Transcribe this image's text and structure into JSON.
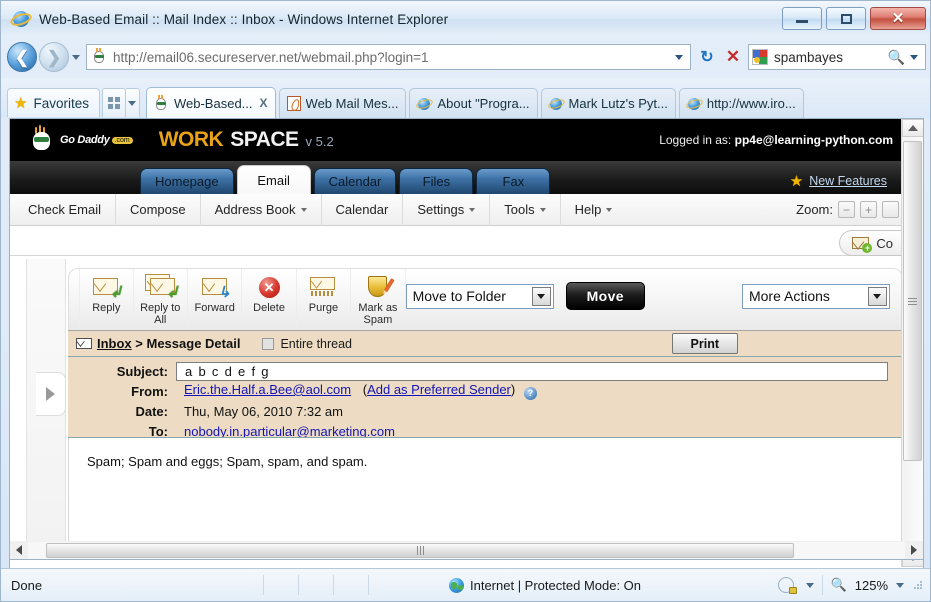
{
  "window": {
    "title": "Web-Based Email :: Mail Index :: Inbox - Windows Internet Explorer",
    "minimize_label": "Minimize",
    "maximize_label": "Maximize",
    "close_label": "Close"
  },
  "address_bar": {
    "url_prefix": "http://",
    "url_domain": "email06.secureserver.net",
    "url_path": "/webmail.php?login=1",
    "url_full": "http://email06.secureserver.net/webmail.php?login=1",
    "refresh_label": "Refresh",
    "stop_label": "Stop",
    "search_value": "spambayes",
    "search_provider": "Google"
  },
  "favorites_bar": {
    "favorites_label": "Favorites",
    "quick_label": "Favorites Bar"
  },
  "browser_tabs": [
    {
      "label": "Web-Based...",
      "active": true,
      "icon": "godaddy-favicon",
      "close": "X"
    },
    {
      "label": "Web Mail Mes...",
      "active": false,
      "icon": "doc-favicon"
    },
    {
      "label": "About \"Progra...",
      "active": false,
      "icon": "ie-favicon"
    },
    {
      "label": "Mark Lutz's Pyt...",
      "active": false,
      "icon": "ie-favicon"
    },
    {
      "label": "http://www.iro...",
      "active": false,
      "icon": "ie-favicon"
    }
  ],
  "gd_header": {
    "brand": "Go Daddy",
    "brand_tld": ".com",
    "product_work": "WORK",
    "product_space": "SPACE",
    "version": "v 5.2",
    "logged_in_prefix": "Logged in as:",
    "logged_in_user": "pp4e@learning-python.com"
  },
  "gd_tabs": [
    {
      "label": "Homepage",
      "active": false
    },
    {
      "label": "Email",
      "active": true
    },
    {
      "label": "Calendar",
      "active": false
    },
    {
      "label": "Files",
      "active": false
    },
    {
      "label": "Fax",
      "active": false
    }
  ],
  "new_features": {
    "label": "New Features"
  },
  "gd_menu": [
    {
      "label": "Check Email",
      "caret": false
    },
    {
      "label": "Compose",
      "caret": false
    },
    {
      "label": "Address Book",
      "caret": true
    },
    {
      "label": "Calendar",
      "caret": false
    },
    {
      "label": "Settings",
      "caret": true
    },
    {
      "label": "Tools",
      "caret": true
    },
    {
      "label": "Help",
      "caret": true
    }
  ],
  "zoom_control": {
    "label": "Zoom:",
    "minus": "−",
    "plus": "+"
  },
  "compose_pill": {
    "label": "Co"
  },
  "sidebar": {
    "expand_label": "Expand sidebar"
  },
  "mail_toolbar": {
    "items": [
      {
        "label": "Reply",
        "icon": "reply-icon"
      },
      {
        "label": "Reply to All",
        "icon": "reply-all-icon"
      },
      {
        "label": "Forward",
        "icon": "forward-icon"
      },
      {
        "label": "Delete",
        "icon": "delete-icon"
      },
      {
        "label": "Purge",
        "icon": "purge-icon"
      },
      {
        "label": "Mark as Spam",
        "icon": "mark-spam-icon"
      }
    ],
    "move_to_folder": "Move to Folder",
    "move_button": "Move",
    "more_actions": "More Actions"
  },
  "message_header": {
    "breadcrumb_folder": "Inbox",
    "breadcrumb_sep": " > ",
    "breadcrumb_page": "Message Detail",
    "entire_thread_label": "Entire thread",
    "entire_thread_checked": false,
    "print_label": "Print"
  },
  "message": {
    "subject_label": "Subject:",
    "subject_value": "a b c d e f g",
    "from_label": "From:",
    "from_value": "Eric.the.Half.a.Bee@aol.com",
    "from_action_open": "(",
    "from_action": "Add as Preferred Sender",
    "from_action_close": ")",
    "date_label": "Date:",
    "date_value": "Thu, May 06, 2010 7:32 am",
    "to_label": "To:",
    "to_value": "nobody.in.particular@marketing.com",
    "body": "Spam; Spam and eggs; Spam, spam, and spam."
  },
  "status_bar": {
    "status": "Done",
    "zone": "Internet | Protected Mode: On",
    "zoom_level": "125%"
  }
}
